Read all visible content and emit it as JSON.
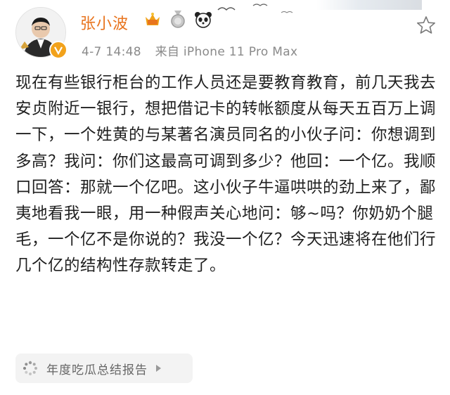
{
  "user": {
    "name": "张小波",
    "badges": [
      "vip-crown-icon",
      "medal-icon",
      "panda-icon"
    ]
  },
  "post": {
    "date": "4-7 14:48",
    "source": "来自 iPhone 11 Pro Max",
    "text": "现在有些银行柜台的工作人员还是要教育教育，前几天我去安贞附近一银行，想把借记卡的转帐额度从每天五百万上调一下，一个姓黄的与某著名演员同名的小伙子问：你想调到多高？我问：你们这最高可调到多少？他回：一个亿。我顺口回答：那就一个亿吧。这小伙子牛逼哄哄的劲上来了，鄙夷地看我一眼，用一种假声关心地问：够~吗？你奶奶个腿毛，一个亿不是你说的？我没一个亿？今天迅速将在他们行几个亿的结构性存款转走了。"
  },
  "topic": {
    "label": "年度吃瓜总结报告"
  },
  "colors": {
    "name": "#e8741e",
    "meta": "#8a8a8a",
    "text": "#1f1f1f",
    "topic_bg": "#f3f3f3"
  }
}
